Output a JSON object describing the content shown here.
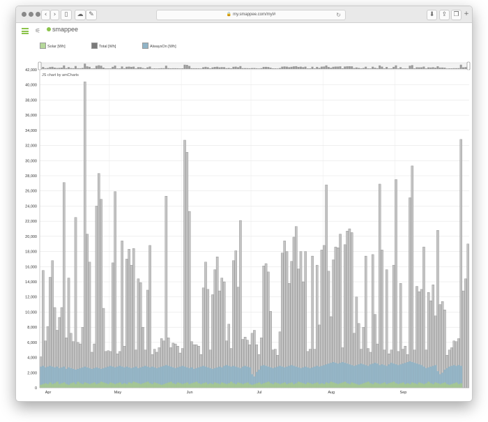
{
  "browser": {
    "url": "my.smappee.com/myl#",
    "back_icon": "chevron-left-icon",
    "forward_icon": "chevron-right-icon"
  },
  "app": {
    "logo": "smappee",
    "menu_icon": "hamburger-icon",
    "filter_icon": "filter-icon",
    "brand_color": "#8bc34a"
  },
  "chart_data": {
    "type": "bar",
    "credit": "JS chart by amCharts",
    "y_ticks": [
      "0",
      "2,000",
      "4,000",
      "6,000",
      "8,000",
      "10,000",
      "12,000",
      "14,000",
      "16,000",
      "18,000",
      "20,000",
      "22,000",
      "24,000",
      "26,000",
      "28,000",
      "30,000",
      "32,000",
      "34,000",
      "36,000",
      "38,000",
      "40,000",
      "42,000"
    ],
    "ylim": [
      0,
      42000
    ],
    "x_ticks": [
      "Apr",
      "May",
      "Jun",
      "Jul",
      "Aug",
      "Sep"
    ],
    "grid": true,
    "legend_position": "top",
    "series": [
      {
        "name": "Solar [Wh]",
        "color": "#b5d89a",
        "stack": "front",
        "values": [
          400,
          500,
          600,
          500,
          700,
          500,
          600,
          800,
          500,
          600,
          700,
          500,
          400,
          600,
          700,
          500,
          800,
          600,
          500,
          700,
          600,
          500,
          600,
          700,
          500,
          600,
          800,
          700,
          600,
          500,
          700,
          600,
          500,
          600,
          700,
          500,
          600,
          500,
          700,
          600,
          800,
          700,
          600,
          500,
          600,
          700,
          800,
          600,
          500,
          700,
          600,
          500,
          400,
          500,
          600,
          700,
          800,
          600,
          500,
          700,
          600,
          500,
          600,
          700,
          500,
          600,
          700,
          800,
          600,
          500,
          600,
          700,
          500,
          600,
          500,
          700,
          600,
          500,
          700,
          600,
          500,
          600,
          800,
          600,
          500,
          700,
          600,
          500,
          600,
          700,
          500,
          400,
          500,
          600,
          700,
          500,
          600,
          700,
          800,
          600,
          500,
          700,
          600,
          500,
          600,
          700,
          500,
          600,
          700,
          500,
          600,
          800,
          700,
          600,
          500,
          700,
          600,
          500,
          600,
          700,
          500,
          600,
          500,
          700,
          600,
          800,
          700,
          600,
          500,
          600,
          700,
          800,
          600,
          500,
          700,
          600,
          500,
          400,
          500,
          600,
          700,
          800,
          600,
          500,
          700,
          600,
          500,
          600,
          700,
          500,
          600,
          700,
          800,
          600,
          500,
          600,
          700,
          500,
          600,
          500,
          700,
          600,
          500,
          700,
          600,
          500,
          600,
          800,
          600,
          500,
          700,
          600,
          500,
          600,
          700,
          500,
          400,
          500,
          600,
          700,
          500,
          600
        ]
      },
      {
        "name": "Total [Wh]",
        "color": "#7a7a7a",
        "stack": "back",
        "values": [
          4100,
          15500,
          6200,
          8100,
          14600,
          16800,
          10600,
          7600,
          9300,
          10600,
          27100,
          6600,
          14500,
          7200,
          6100,
          22500,
          6000,
          5800,
          8000,
          40400,
          20300,
          16600,
          4700,
          5800,
          24000,
          28300,
          24900,
          10500,
          4800,
          4900,
          4800,
          16500,
          25900,
          4500,
          4800,
          19400,
          5500,
          17000,
          18300,
          16200,
          18400,
          5000,
          14400,
          13900,
          8000,
          5000,
          12900,
          18800,
          4400,
          5100,
          4700,
          5300,
          6500,
          6200,
          25300,
          6600,
          5300,
          5900,
          5800,
          5500,
          4600,
          5200,
          32700,
          31100,
          23300,
          6100,
          5700,
          5700,
          5500,
          4400,
          13200,
          16600,
          13000,
          5000,
          12300,
          15600,
          17300,
          12800,
          14500,
          14000,
          6200,
          8400,
          5200,
          16800,
          18100,
          13300,
          22100,
          6400,
          6700,
          6300,
          5700,
          7200,
          7600,
          5700,
          4400,
          6600,
          16100,
          16400,
          15300,
          10100,
          5000,
          5100,
          4300,
          7400,
          17800,
          19400,
          18000,
          13800,
          16700,
          19900,
          21300,
          15700,
          18000,
          14000,
          18000,
          4800,
          5100,
          17400,
          5100,
          16200,
          8300,
          18200,
          18800,
          26800,
          15400,
          9400,
          16900,
          18600,
          18500,
          20300,
          5300,
          18900,
          20700,
          21000,
          20500,
          7200,
          12000,
          8500,
          5100,
          8000,
          17400,
          5200,
          4700,
          17600,
          9700,
          5800,
          26900,
          18200,
          5000,
          15600,
          4500,
          5000,
          16200,
          27500,
          4800,
          13800,
          5100,
          5500,
          4400,
          25100,
          29300,
          5000,
          13400,
          12700,
          13000,
          18600,
          5000,
          12600,
          11500,
          13600,
          9500,
          20800,
          11000,
          11400,
          10300,
          4300,
          5000,
          5300,
          6200,
          6100,
          6500,
          32800,
          12800,
          14400,
          19000
        ]
      },
      {
        "name": "AlwaysOn [Wh]",
        "color": "#90b4c7",
        "stack": "middle",
        "values": [
          2800,
          2900,
          2700,
          2800,
          2900,
          2800,
          2700,
          2800,
          2600,
          2700,
          2800,
          2500,
          2700,
          2600,
          2500,
          2400,
          2500,
          2600,
          2700,
          2800,
          2700,
          2600,
          2500,
          2600,
          2700,
          2600,
          2500,
          2600,
          2700,
          2800,
          2900,
          2800,
          2700,
          2800,
          2900,
          2800,
          2700,
          2800,
          2700,
          2600,
          2700,
          2800,
          2600,
          2700,
          2800,
          2900,
          2800,
          2700,
          2800,
          2700,
          2600,
          2700,
          2800,
          2900,
          3000,
          2900,
          2800,
          2700,
          2600,
          2700,
          2800,
          2900,
          2800,
          2700,
          2600,
          2700,
          2500,
          2600,
          2700,
          2800,
          2900,
          2800,
          2700,
          2600,
          2500,
          2600,
          2700,
          2800,
          2700,
          2900,
          3000,
          2900,
          2800,
          2900,
          2800,
          2700,
          2600,
          2800,
          2900,
          2800,
          2700,
          1800,
          1500,
          2100,
          2400,
          2900,
          3000,
          2900,
          2800,
          2700,
          2600,
          2700,
          2800,
          2900,
          2800,
          2700,
          2800,
          2900,
          3000,
          2900,
          2800,
          2700,
          2600,
          2700,
          2800,
          2700,
          2600,
          2700,
          2800,
          2900,
          2800,
          2900,
          3000,
          3100,
          3200,
          3300,
          3400,
          3300,
          3200,
          3300,
          3400,
          3300,
          3200,
          3100,
          3000,
          2900,
          3000,
          3100,
          3200,
          3100,
          3000,
          2900,
          3100,
          3200,
          3300,
          3200,
          3000,
          3100,
          3000,
          2900,
          3100,
          3300,
          3200,
          3100,
          3000,
          3100,
          3200,
          3300,
          3400,
          3500,
          3400,
          3300,
          3200,
          3100,
          3000,
          2800,
          2600,
          2700,
          2800,
          2900,
          3000,
          2200,
          1800,
          2000,
          2400,
          2600,
          2800,
          2900,
          3000,
          2900,
          3000,
          2900
        ]
      }
    ]
  }
}
